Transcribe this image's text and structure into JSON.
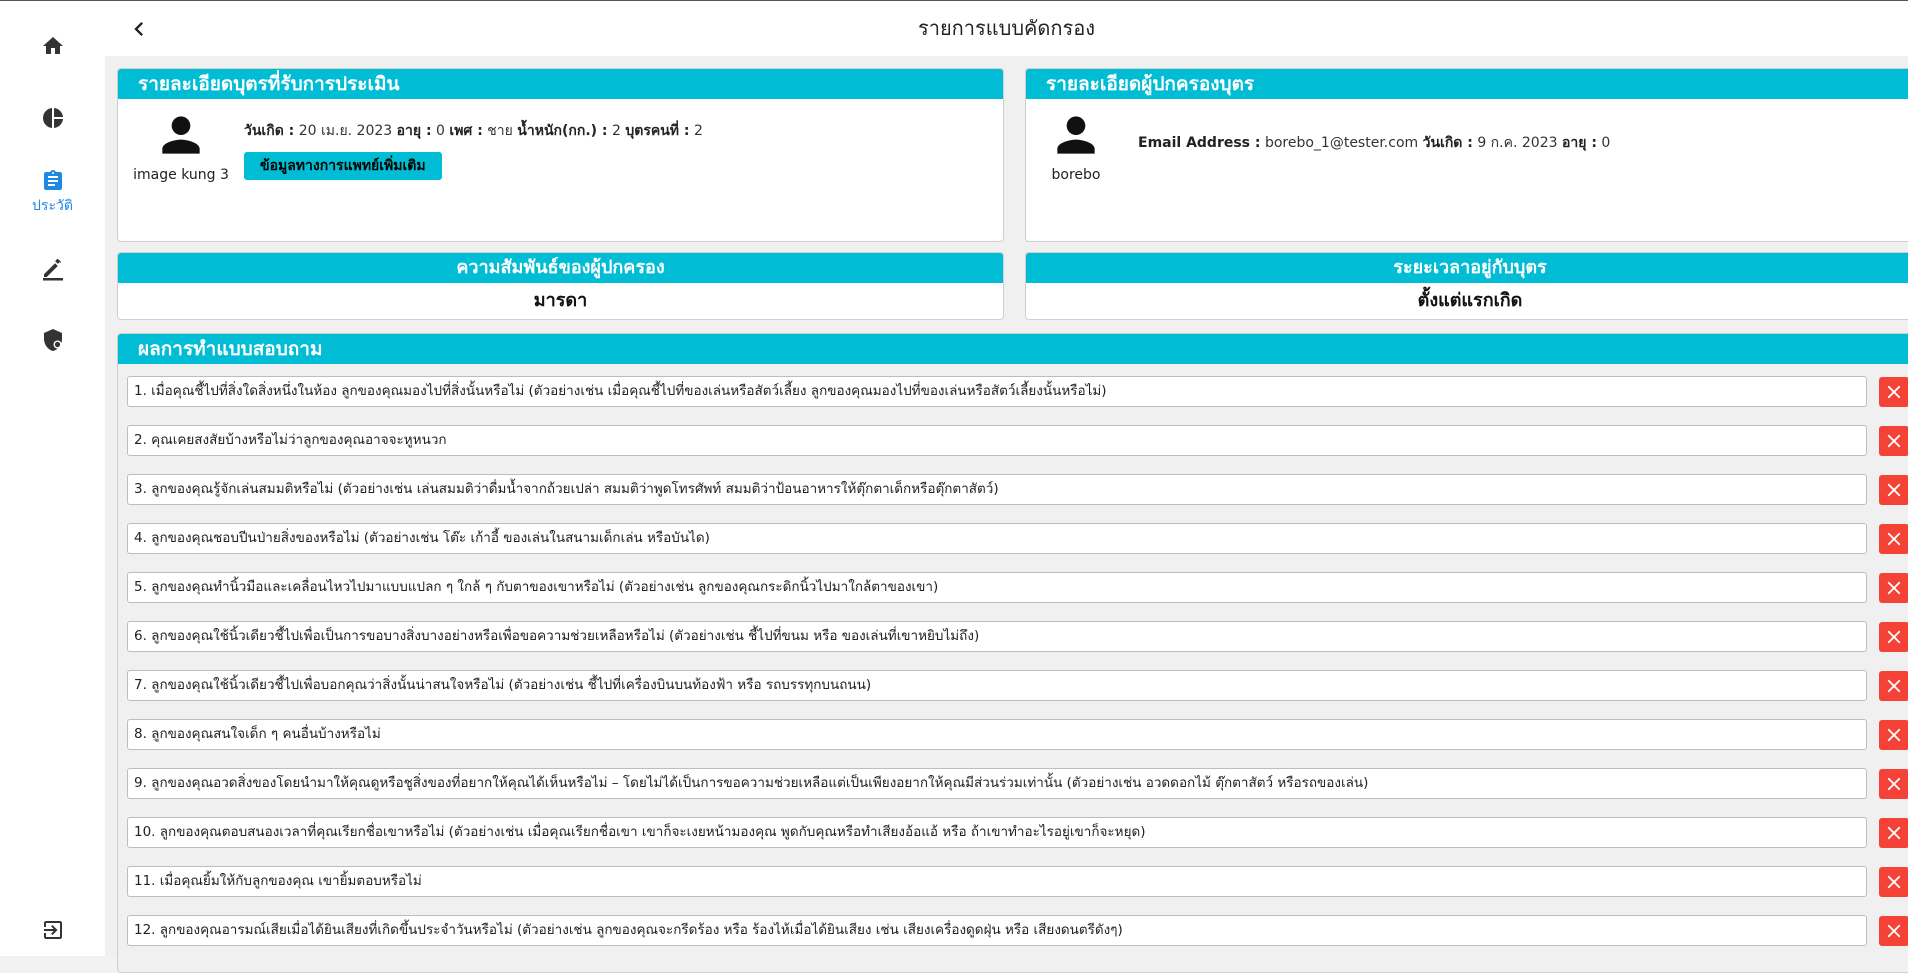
{
  "header": {
    "title": "รายการแบบคัดกรอง"
  },
  "sidebar": {
    "items": [
      {
        "icon": "home-icon",
        "label": ""
      },
      {
        "icon": "pie-chart-icon",
        "label": ""
      },
      {
        "icon": "clipboard-icon",
        "label": "ประวัติ",
        "active": true
      },
      {
        "icon": "edit-icon",
        "label": ""
      },
      {
        "icon": "shield-icon",
        "label": ""
      },
      {
        "icon": "logout-icon",
        "label": ""
      }
    ]
  },
  "child": {
    "heading": "รายละเอียดบุตรที่รับการประเมิน",
    "name": "image kung 3",
    "birth_label": "วันเกิด :",
    "birth_value": "20 เม.ย. 2023",
    "age_label": "อายุ :",
    "age_value": "0",
    "sex_label": "เพศ :",
    "sex_value": "ชาย",
    "weight_label": "น้ำหนัก(กก.) :",
    "weight_value": "2",
    "order_label": "บุตรคนที่ :",
    "order_value": "2",
    "medical_button": "ข้อมูลทางการแพทย์เพิ่มเติม"
  },
  "parent": {
    "heading": "รายละเอียดผู้ปกครองบุตร",
    "name": "borebo",
    "email_label": "Email Address :",
    "email_value": "borebo_1@tester.com",
    "birth_label": "วันเกิด :",
    "birth_value": "9 ก.ค. 2023",
    "age_label": "อายุ :",
    "age_value": "0"
  },
  "relationship": {
    "heading": "ความสัมพันธ์ของผู้ปกครอง",
    "value": "มารดา"
  },
  "duration": {
    "heading": "ระยะเวลาอยู่กับบุตร",
    "value": "ตั้งแต่แรกเกิด"
  },
  "results": {
    "heading": "ผลการทำแบบสอบถาม",
    "questions": [
      "1. เมื่อคุณชี้ไปที่สิ่งใดสิ่งหนึ่งในห้อง ลูกของคุณมองไปที่สิ่งนั้นหรือไม่ (ตัวอย่างเช่น เมื่อคุณชี้ไปที่ของเล่นหรือสัตว์เลี้ยง ลูกของคุณมองไปที่ของเล่นหรือสัตว์เลี้ยงนั้นหรือไม่)",
      "2. คุณเคยสงสัยบ้างหรือไม่ว่าลูกของคุณอาจจะหูหนวก",
      "3. ลูกของคุณรู้จักเล่นสมมติหรือไม่ (ตัวอย่างเช่น เล่นสมมติว่าดื่มน้ำจากถ้วยเปล่า สมมติว่าพูดโทรศัพท์ สมมติว่าป้อนอาหารให้ตุ๊กตาเด็กหรือตุ๊กตาสัตว์)",
      "4. ลูกของคุณชอบปีนป่ายสิ่งของหรือไม่ (ตัวอย่างเช่น โต๊ะ เก้าอี้ ของเล่นในสนามเด็กเล่น หรือบันได)",
      "5. ลูกของคุณทำนิ้วมือและเคลื่อนไหวไปมาแบบแปลก ๆ ใกล้ ๆ กับตาของเขาหรือไม่ (ตัวอย่างเช่น ลูกของคุณกระดิกนิ้วไปมาใกล้ตาของเขา)",
      "6. ลูกของคุณใช้นิ้วเดียวชี้ไปเพื่อเป็นการขอบางสิ่งบางอย่างหรือเพื่อขอความช่วยเหลือหรือไม่  (ตัวอย่างเช่น ชี้ไปที่ขนม หรือ ของเล่นที่เขาหยิบไม่ถึง)",
      "7. ลูกของคุณใช้นิ้วเดียวชี้ไปเพื่อบอกคุณว่าสิ่งนั้นน่าสนใจหรือไม่ (ตัวอย่างเช่น ชี้ไปที่เครื่องบินบนท้องฟ้า หรือ รถบรรทุกบนถนน)",
      "8. ลูกของคุณสนใจเด็ก ๆ คนอื่นบ้างหรือไม่",
      "9. ลูกของคุณอวดสิ่งของโดยนำมาให้คุณดูหรือชูสิ่งของที่อยากให้คุณได้เห็นหรือไม่ – โดยไม่ได้เป็นการขอความช่วยเหลือแต่เป็นเพียงอยากให้คุณมีส่วนร่วมเท่านั้น (ตัวอย่างเช่น อวดดอกไม้ ตุ๊กตาสัตว์ หรือรถของเล่น)",
      "10. ลูกของคุณตอบสนองเวลาที่คุณเรียกชื่อเขาหรือไม่ (ตัวอย่างเช่น เมื่อคุณเรียกชื่อเขา เขาก็จะเงยหน้ามองคุณ พูดกับคุณหรือทำเสียงอ้อแอ้ หรือ ถ้าเขาทำอะไรอยู่เขาก็จะหยุด)",
      "11. เมื่อคุณยิ้มให้กับลูกของคุณ เขายิ้มตอบหรือไม่",
      "12. ลูกของคุณอารมณ์เสียเมื่อได้ยินเสียงที่เกิดขึ้นประจำวันหรือไม่ (ตัวอย่างเช่น ลูกของคุณจะกรีดร้อง หรือ ร้องไห้เมื่อได้ยินเสียง เช่น เสียงเครื่องดูดฝุ่น หรือ เสียงดนตรีดังๆ)"
    ]
  },
  "colors": {
    "accent": "#00bcd4",
    "delete": "#f44336",
    "active_nav": "#1e88e5",
    "nav_icon": "#333333"
  }
}
